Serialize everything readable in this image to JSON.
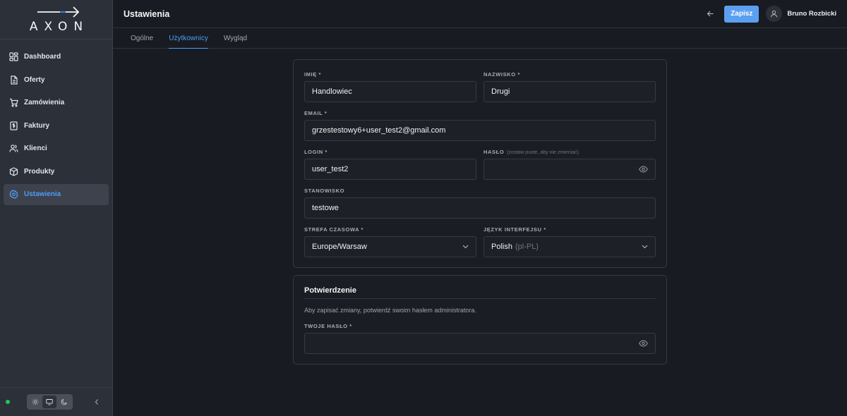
{
  "sidebar": {
    "logo_text": "AXON",
    "items": [
      {
        "label": "Dashboard",
        "icon": "dashboard-icon"
      },
      {
        "label": "Oferty",
        "icon": "document-icon"
      },
      {
        "label": "Zamówienia",
        "icon": "cart-icon"
      },
      {
        "label": "Faktury",
        "icon": "invoice-icon"
      },
      {
        "label": "Klienci",
        "icon": "users-icon"
      },
      {
        "label": "Produkty",
        "icon": "box-icon"
      },
      {
        "label": "Ustawienia",
        "icon": "gear-icon",
        "active": true
      }
    ],
    "status": "online",
    "theme_options": [
      "light",
      "system",
      "dark"
    ],
    "theme_selected": "system"
  },
  "header": {
    "title": "Ustawienia",
    "save_label": "Zapisz",
    "user_name": "Bruno Rozbicki"
  },
  "tabs": [
    {
      "label": "Ogólne"
    },
    {
      "label": "Użytkownicy",
      "active": true
    },
    {
      "label": "Wygląd"
    }
  ],
  "form": {
    "first_name": {
      "label": "IMIĘ *",
      "value": "Handlowiec"
    },
    "last_name": {
      "label": "NAZWISKO *",
      "value": "Drugi"
    },
    "email": {
      "label": "EMAIL *",
      "value": "grzestestowy6+user_test2@gmail.com"
    },
    "login": {
      "label": "LOGIN *",
      "value": "user_test2"
    },
    "password": {
      "label": "HASŁO",
      "hint": "(zostaw puste, aby nie zmieniać)",
      "value": ""
    },
    "position": {
      "label": "STANOWISKO",
      "value": "testowe"
    },
    "timezone": {
      "label": "STREFA CZASOWA *",
      "value": "Europe/Warsaw"
    },
    "language": {
      "label": "JĘZYK INTERFEJSU *",
      "value": "Polish",
      "suffix": "(pl-PL)"
    }
  },
  "confirmation": {
    "title": "Potwierdzenie",
    "description": "Aby zapisać zmiany, potwierdź swoim hasłem administratora.",
    "admin_password": {
      "label": "TWOJE HASŁO *",
      "value": ""
    }
  },
  "colors": {
    "accent": "#4f9cf5",
    "primary_button": "#5b9ff0",
    "status_online": "#22c55e"
  }
}
